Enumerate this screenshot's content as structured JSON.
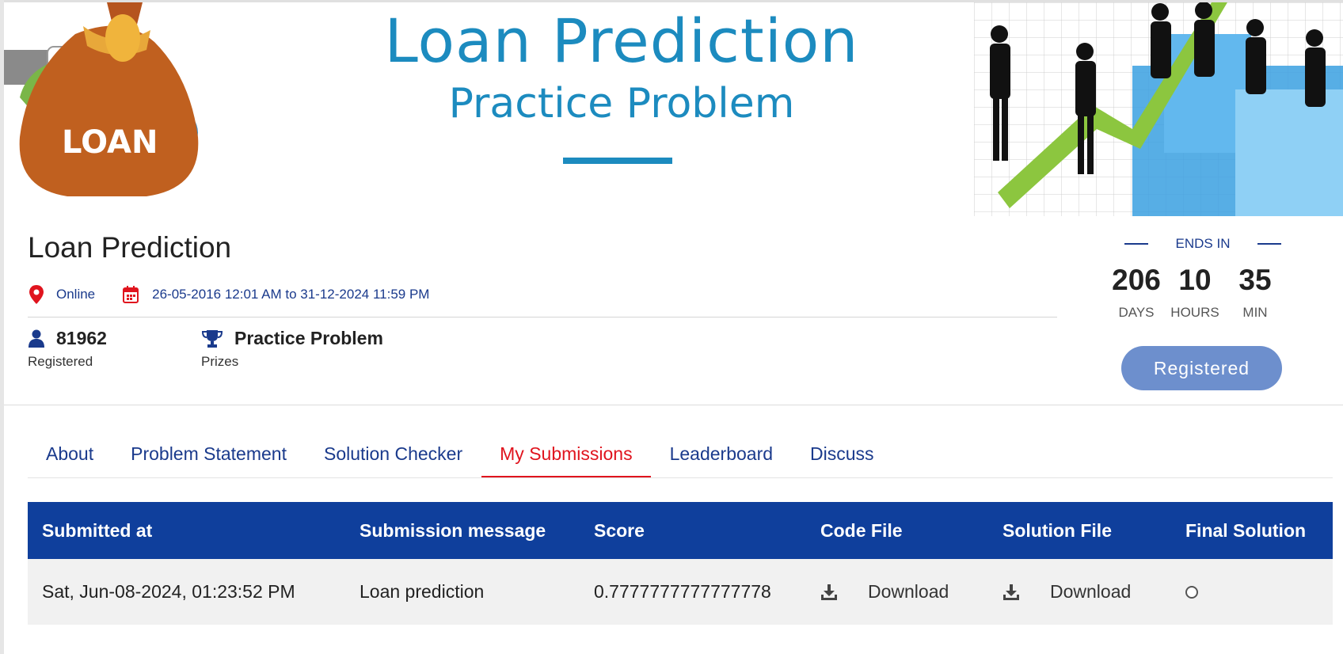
{
  "banner": {
    "title": "Loan Prediction",
    "subtitle": "Practice Problem",
    "bag_label": "LOAN"
  },
  "header": {
    "title": "Loan Prediction",
    "location": "Online",
    "date_range": "26-05-2016 12:01 AM to 31-12-2024 11:59 PM",
    "registered_count": "81962",
    "registered_label": "Registered",
    "prize_value": "Practice Problem",
    "prize_label": "Prizes"
  },
  "countdown": {
    "ends_label": "ENDS IN",
    "days": "206",
    "days_label": "DAYS",
    "hours": "10",
    "hours_label": "HOURS",
    "minutes": "35",
    "minutes_label": "MIN",
    "button_label": "Registered"
  },
  "tabs": [
    {
      "label": "About"
    },
    {
      "label": "Problem Statement"
    },
    {
      "label": "Solution Checker"
    },
    {
      "label": "My Submissions"
    },
    {
      "label": "Leaderboard"
    },
    {
      "label": "Discuss"
    }
  ],
  "active_tab": "My Submissions",
  "table": {
    "headers": [
      "Submitted at",
      "Submission message",
      "Score",
      "Code File",
      "Solution File",
      "Final Solution"
    ],
    "rows": [
      {
        "submitted_at": "Sat, Jun-08-2024, 01:23:52 PM",
        "message": "Loan prediction",
        "score": "0.7777777777777778",
        "code_file": "Download",
        "solution_file": "Download",
        "final_solution_selected": false
      }
    ]
  },
  "colors": {
    "brand_blue": "#0f3f9c",
    "link_blue": "#1a3a8c",
    "accent_red": "#e0141e",
    "banner_blue": "#1c8bbf",
    "button_blue": "#6d8fcd"
  },
  "icons": [
    "map-pin-icon",
    "calendar-icon",
    "user-icon",
    "trophy-icon",
    "download-icon",
    "radio-icon"
  ]
}
